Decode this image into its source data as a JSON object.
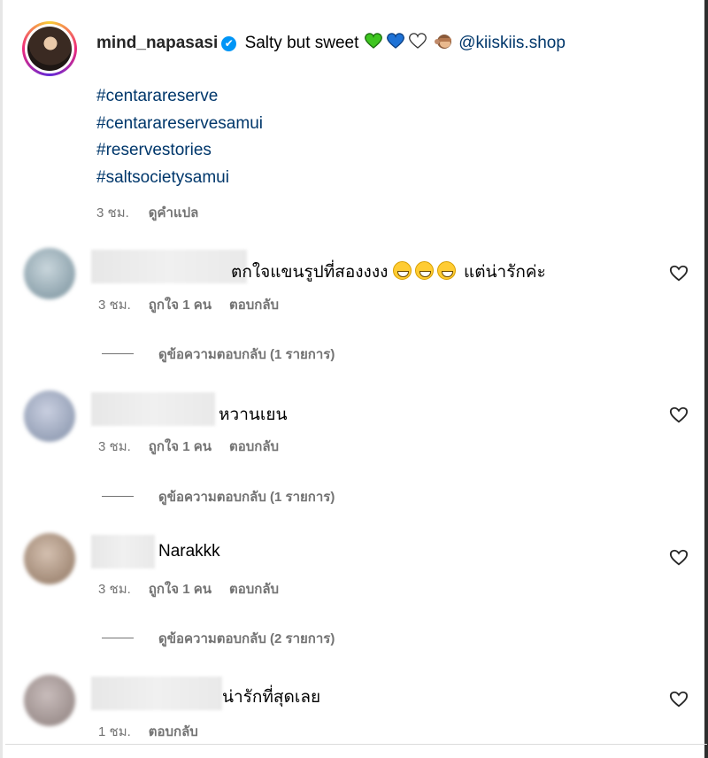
{
  "post": {
    "username": "mind_napasasi",
    "verified": true,
    "caption_text": "Salty but sweet",
    "caption_emoji": "💚💙🤍",
    "caption_extra_emoji": "🐵",
    "mention": "@kiiskiis.shop",
    "hashtags": [
      "#centarareserve",
      "#centarareservesamui",
      "#reservestories",
      "#saltsocietysamui"
    ],
    "time": "3 ชม.",
    "translate_label": "ดูคำแปล"
  },
  "comments": [
    {
      "text": "ตกใจแขนรูปที่สองงงง",
      "text_suffix": "แต่น่ารักค่ะ",
      "emoji_count": 3,
      "time": "3 ชม.",
      "likes": "ถูกใจ 1 คน",
      "reply_label": "ตอบกลับ",
      "view_replies": "ดูข้อความตอบกลับ (1 รายการ)",
      "avatar_color": "#9fb2bd"
    },
    {
      "text": "หวานเยน",
      "time": "3 ชม.",
      "likes": "ถูกใจ 1 คน",
      "reply_label": "ตอบกลับ",
      "view_replies": "ดูข้อความตอบกลับ (1 รายการ)",
      "avatar_color": "#a7b0c3"
    },
    {
      "text": "Narakkk",
      "time": "3 ชม.",
      "likes": "ถูกใจ 1 คน",
      "reply_label": "ตอบกลับ",
      "view_replies": "ดูข้อความตอบกลับ (2 รายการ)",
      "avatar_color": "#b8a08e"
    },
    {
      "text": "น่ารักที่สุดเลย",
      "time": "1 ชม.",
      "reply_label": "ตอบกลับ",
      "avatar_color": "#a69a98"
    }
  ],
  "colors": {
    "link": "#00376b",
    "meta": "#737373",
    "verified": "#0095f6"
  }
}
